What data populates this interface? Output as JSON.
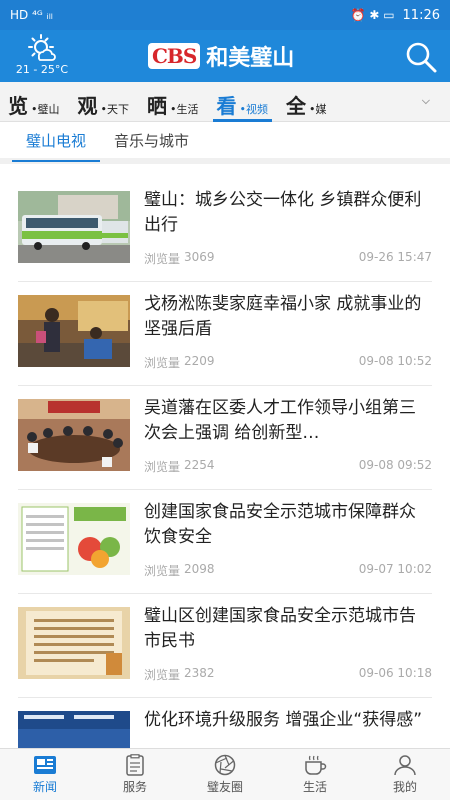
{
  "status_bar": {
    "time": "11:26",
    "left_glyphs": "HD ⁴ᴳ ᵢₗₗ",
    "right_glyphs": "⏰ ✱ ▭"
  },
  "weather": {
    "temp": "21 - 25°C"
  },
  "brand": {
    "logo": "CBS",
    "name": "和美璧山"
  },
  "channels": [
    {
      "big": "览",
      "small": "•璧山"
    },
    {
      "big": "观",
      "small": "•天下"
    },
    {
      "big": "晒",
      "small": "•生活"
    },
    {
      "big": "看",
      "small": "•视频"
    },
    {
      "big": "全",
      "small": "•媒"
    }
  ],
  "subtabs": [
    "璧山电视",
    "音乐与城市"
  ],
  "feed": [
    {
      "title": "璧山：城乡公交一体化 乡镇群众便利出行",
      "views_label": "浏览量",
      "views": "3069",
      "time": "09-26 15:47"
    },
    {
      "title": "戈杨淞陈斐家庭幸福小家 成就事业的坚强后盾",
      "views_label": "浏览量",
      "views": "2209",
      "time": "09-08 10:52"
    },
    {
      "title": "吴道藩在区委人才工作领导小组第三次会上强调  给创新型…",
      "views_label": "浏览量",
      "views": "2254",
      "time": "09-08 09:52"
    },
    {
      "title": "创建国家食品安全示范城市保障群众饮食安全",
      "views_label": "浏览量",
      "views": "2098",
      "time": "09-07 10:02"
    },
    {
      "title": "璧山区创建国家食品安全示范城市告市民书",
      "views_label": "浏览量",
      "views": "2382",
      "time": "09-06 10:18"
    },
    {
      "title": "优化环境升级服务 增强企业“获得感”",
      "views_label": "",
      "views": "",
      "time": ""
    }
  ],
  "tabbar": [
    {
      "label": "新闻",
      "icon": "news-icon"
    },
    {
      "label": "服务",
      "icon": "service-icon"
    },
    {
      "label": "璧友圈",
      "icon": "aperture-icon"
    },
    {
      "label": "生活",
      "icon": "cup-icon"
    },
    {
      "label": "我的",
      "icon": "profile-icon"
    }
  ],
  "colors": {
    "primary": "#1f88da",
    "accent": "#1a7cd4",
    "logo_red": "#d7262b"
  }
}
